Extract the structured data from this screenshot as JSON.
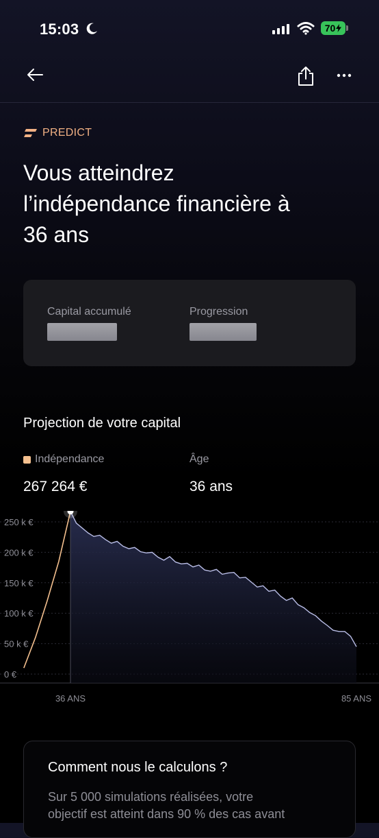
{
  "status_bar": {
    "time": "15:03",
    "battery": "70"
  },
  "icons": {
    "moon": "moon-icon",
    "signal": "signal-icon",
    "wifi": "wifi-icon",
    "back": "arrow-left-icon",
    "share": "share-icon",
    "more": "ellipsis-icon"
  },
  "header": {
    "brand": "PREDICT",
    "headline_line1": "Vous atteindrez",
    "headline_line2": "l’indépendance financière à",
    "headline_line3": "36 ans"
  },
  "summary_card": {
    "capital_label": "Capital accumulé",
    "progress_label": "Progression"
  },
  "projection": {
    "title": "Projection de votre capital",
    "legend_label": "Indépendance",
    "age_label": "Âge",
    "independence_value": "267 264 €",
    "age_value": "36 ans"
  },
  "colors": {
    "accent": "#f2b184",
    "line_before": "#f4c08f",
    "line_after": "#b9bde6"
  },
  "chart_data": {
    "type": "area",
    "x_tick_labels": [
      "36 ANS",
      "85 ANS"
    ],
    "y_tick_labels": [
      "250 k €",
      "200 k €",
      "150 k €",
      "100 k €",
      "50 k €",
      "0 €"
    ],
    "y_ticks": [
      250000,
      200000,
      150000,
      100000,
      50000,
      0
    ],
    "ylim": [
      0,
      265000
    ],
    "xlim": [
      28,
      86
    ],
    "grid": true,
    "highlight": {
      "x": 36,
      "y": 267264
    },
    "series": [
      {
        "x": [
          28,
          30,
          32,
          34,
          36
        ],
        "y": [
          10000,
          60000,
          120000,
          185000,
          267264
        ]
      },
      {
        "x": [
          36,
          37,
          38,
          39,
          40,
          41,
          42,
          43,
          44,
          45,
          46,
          47,
          48,
          49,
          50,
          51,
          52,
          53,
          54,
          55,
          56,
          57,
          58,
          59,
          60,
          61,
          62,
          63,
          64,
          65,
          66,
          67,
          68,
          69,
          70,
          71,
          72,
          73,
          74,
          75,
          76,
          77,
          78,
          79,
          80,
          81,
          82,
          83,
          84,
          85
        ],
        "y": [
          267264,
          248000,
          240000,
          232000,
          226000,
          228000,
          221000,
          215000,
          218000,
          210000,
          206000,
          208000,
          201000,
          199000,
          200000,
          192000,
          187000,
          193000,
          184000,
          181000,
          182000,
          176000,
          179000,
          171000,
          169000,
          172000,
          164000,
          166000,
          167000,
          158000,
          159000,
          151000,
          143000,
          145000,
          136000,
          138000,
          128000,
          121000,
          125000,
          114000,
          109000,
          101000,
          96000,
          87000,
          80000,
          72000,
          70000,
          70000,
          62000,
          45000
        ]
      }
    ]
  },
  "calc_card": {
    "title": "Comment nous le calculons ?",
    "text_line1": "Sur 5 000 simulations réalisées, votre",
    "text_line2": "objectif est atteint dans 90 % des cas avant"
  }
}
